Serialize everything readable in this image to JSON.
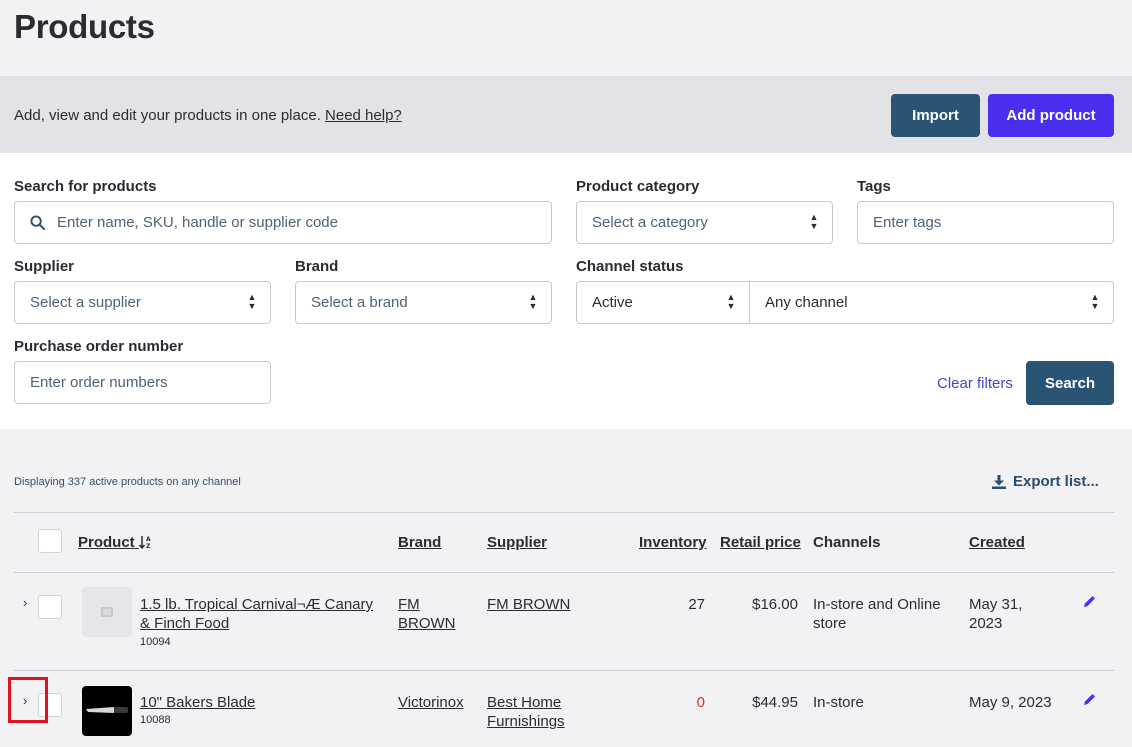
{
  "page": {
    "title": "Products"
  },
  "help": {
    "text": "Add, view and edit your products in one place.",
    "link": "Need help?"
  },
  "actions": {
    "import": "Import",
    "add_product": "Add product"
  },
  "filters": {
    "search": {
      "label": "Search for products",
      "placeholder": "Enter name, SKU, handle or supplier code"
    },
    "category": {
      "label": "Product category",
      "value": "Select a category"
    },
    "tags": {
      "label": "Tags",
      "placeholder": "Enter tags"
    },
    "supplier": {
      "label": "Supplier",
      "value": "Select a supplier"
    },
    "brand": {
      "label": "Brand",
      "value": "Select a brand"
    },
    "channel_status": {
      "label": "Channel status",
      "status_value": "Active",
      "channel_value": "Any channel"
    },
    "po_number": {
      "label": "Purchase order number",
      "placeholder": "Enter order numbers"
    },
    "clear": "Clear filters",
    "search_button": "Search"
  },
  "results": {
    "summary": "Displaying 337 active products on any channel",
    "export": "Export list..."
  },
  "table": {
    "headers": {
      "product": "Product",
      "brand": "Brand",
      "supplier": "Supplier",
      "inventory": "Inventory",
      "retail_price": "Retail price",
      "channels": "Channels",
      "created": "Created"
    },
    "rows": [
      {
        "name_line1": "1.5 lb. Tropical Carnival¬Æ Canary",
        "name_line2": "& Finch Food",
        "sku": "10094",
        "brand_line1": "FM",
        "brand_line2": "BROWN",
        "supplier_line1": "FM BROWN",
        "supplier_line2": "",
        "inventory": "27",
        "price": "$16.00",
        "channels_line1": "In-store and Online",
        "channels_line2": "store",
        "created_line1": "May 31,",
        "created_line2": "2023"
      },
      {
        "name_line1": "10\" Bakers Blade",
        "name_line2": "",
        "sku": "10088",
        "brand_line1": "Victorinox",
        "brand_line2": "",
        "supplier_line1": "Best Home",
        "supplier_line2": "Furnishings",
        "inventory": "0",
        "price": "$44.95",
        "channels_line1": "In-store",
        "channels_line2": "",
        "created_line1": "May 9, 2023",
        "created_line2": ""
      }
    ]
  },
  "colors": {
    "primary": "#2a5473",
    "accent": "#4a2ff0",
    "link": "#3b46c8",
    "danger": "#d0342c"
  }
}
